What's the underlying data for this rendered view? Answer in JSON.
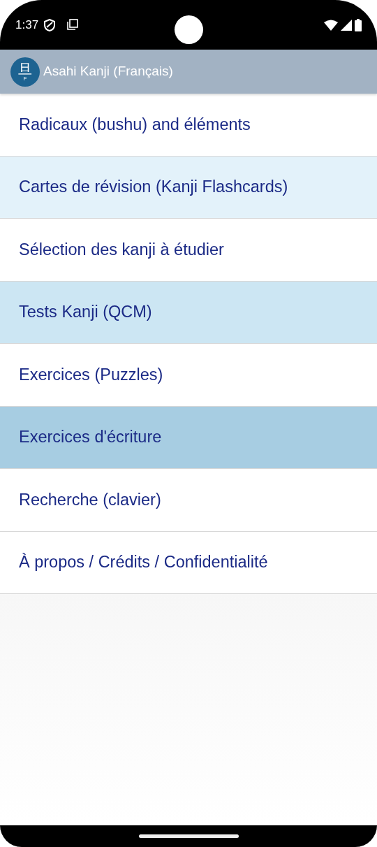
{
  "status_bar": {
    "time": "1:37"
  },
  "app_bar": {
    "logo": {
      "glyph": "旦",
      "letter": "F"
    },
    "title": "Asahi Kanji (Français)"
  },
  "menu": [
    {
      "label": "Radicaux (bushu) and éléments",
      "color": "#ffffff"
    },
    {
      "label": "Cartes de révision (Kanji Flashcards)",
      "color": "#e3f2fa"
    },
    {
      "label": "Sélection des kanji à étudier",
      "color": "#ffffff"
    },
    {
      "label": "Tests Kanji (QCM)",
      "color": "#cce6f3"
    },
    {
      "label": "Exercices (Puzzles)",
      "color": "#ffffff"
    },
    {
      "label": "Exercices d'écriture",
      "color": "#a7cde2"
    },
    {
      "label": "Recherche (clavier)",
      "color": "#ffffff"
    },
    {
      "label": "À propos / Crédits / Confidentialité",
      "color": "#ffffff"
    }
  ]
}
